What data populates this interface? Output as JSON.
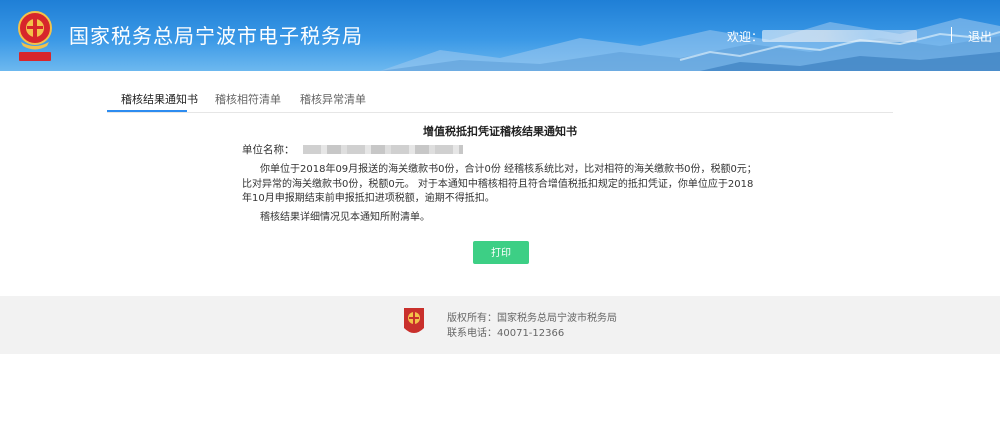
{
  "header": {
    "site_title": "国家税务总局宁波市电子税务局",
    "welcome_label": "欢迎：",
    "logout_label": "退出",
    "brand_color": "#1f7fd6"
  },
  "tabs": [
    {
      "label": "稽核结果通知书",
      "active": true
    },
    {
      "label": "稽核相符清单",
      "active": false
    },
    {
      "label": "稽核异常清单",
      "active": false
    }
  ],
  "notice": {
    "title": "增值税抵扣凭证稽核结果通知书",
    "unit_label": "单位名称：",
    "paragraph1": "你单位于2018年09月报送的海关缴款书0份，合计0份 经稽核系统比对，比对相符的海关缴款书0份，税额0元；比对异常的海关缴款书0份，税额0元。 对于本通知中稽核相符且符合增值税抵扣规定的抵扣凭证，你单位应于2018年10月申报期结束前申报抵扣进项税额，逾期不得抵扣。",
    "paragraph2": "稽核结果详细情况见本通知所附清单。",
    "print_label": "打印",
    "print_color": "#3dcf85"
  },
  "footer": {
    "copyright": "版权所有：国家税务总局宁波市税务局",
    "phone": "联系电话：40071-12366"
  }
}
